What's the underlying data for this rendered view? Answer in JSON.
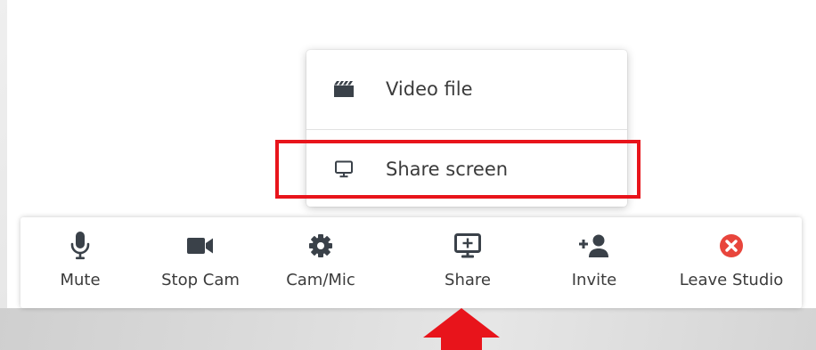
{
  "share_menu": {
    "items": [
      {
        "label": "Video file",
        "icon": "film-icon"
      },
      {
        "label": "Share screen",
        "icon": "monitor-icon"
      }
    ],
    "highlighted": "Share screen"
  },
  "toolbar": {
    "buttons": [
      {
        "label": "Mute",
        "icon": "microphone-icon"
      },
      {
        "label": "Stop Cam",
        "icon": "video-camera-icon"
      },
      {
        "label": "Cam/Mic",
        "icon": "gear-icon"
      },
      {
        "label": "Share",
        "icon": "share-screen-icon"
      },
      {
        "label": "Invite",
        "icon": "add-user-icon"
      },
      {
        "label": "Leave Studio",
        "icon": "leave-close-icon"
      }
    ]
  },
  "colors": {
    "icon": "#3a4149",
    "text": "#3b3b3b",
    "leave": "#e8453c",
    "annotation": "#e8141b"
  }
}
